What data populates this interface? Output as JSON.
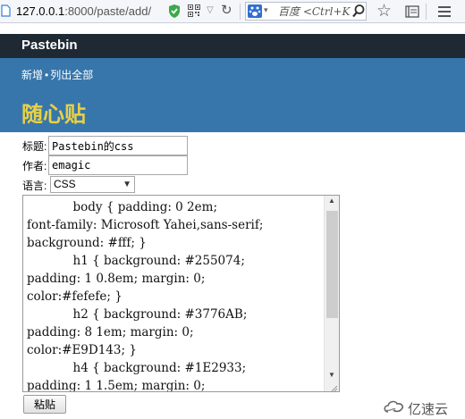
{
  "browser": {
    "url_host": "127.0.0.1",
    "url_path": ":8000/paste/add/",
    "search_placeholder": "百度 <Ctrl+K"
  },
  "site": {
    "title": "Pastebin",
    "nav": [
      {
        "label": "新增"
      },
      {
        "label": "列出全部"
      }
    ],
    "nav_separator": "•",
    "heading": "随心贴"
  },
  "colors": {
    "title_bar": "#1E2933",
    "header_bg": "#3776AB",
    "heading": "#E9D143"
  },
  "form": {
    "title_label": "标题:",
    "title_value": "Pastebin的css",
    "author_label": "作者:",
    "author_value": "emagic",
    "language_label": "语言:",
    "language_value": "CSS",
    "code": "            body { padding: 0 2em;\nfont-family: Microsoft Yahei,sans-serif;\nbackground: #fff; }\n            h1 { background: #255074;\npadding: 1 0.8em; margin: 0;\ncolor:#fefefe; }\n            h2 { background: #3776AB;\npadding: 8 1em; margin: 0;\ncolor:#E9D143; }\n            h4 { background: #1E2933;\npadding: 1 1.5em; margin: 0;",
    "submit_label": "粘贴"
  },
  "watermark": {
    "text": "亿速云"
  }
}
